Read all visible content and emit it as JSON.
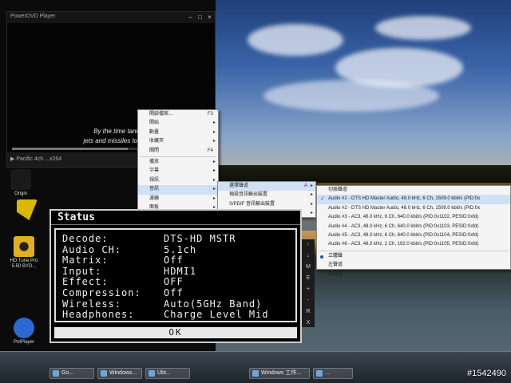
{
  "player": {
    "title": "PowerDVD Player",
    "subtitle_line1": "By the time tanks,",
    "subtitle_line2": "jets and missiles took it d",
    "progress": 0.58,
    "control_text": "Pacific  4ch  ...x264"
  },
  "desktop_icons": [
    {
      "label": "Origin",
      "color": "#d8c000"
    },
    {
      "label": "",
      "color": "#e3c02a"
    },
    {
      "label": "HD Tune Pro 5.50 BYD...",
      "color": "#d4a020"
    },
    {
      "label": "PotPlayer",
      "color": "#2a6ad0"
    }
  ],
  "context_menu": {
    "items": [
      {
        "label": "開啟檔案...",
        "accel": "F3",
        "submenu": false
      },
      {
        "label": "開始",
        "accel": "",
        "submenu": true
      },
      {
        "label": "動畫",
        "accel": "",
        "submenu": true
      },
      {
        "label": "收藏夾",
        "accel": "",
        "submenu": true
      },
      {
        "label": "關閉",
        "accel": "F4",
        "submenu": false
      },
      {
        "label": "播放",
        "accel": "",
        "submenu": true
      },
      {
        "label": "字幕",
        "accel": "",
        "submenu": true
      },
      {
        "label": "視訊",
        "accel": "",
        "submenu": true
      },
      {
        "label": "音訊",
        "accel": "",
        "submenu": true,
        "highlight": true
      },
      {
        "label": "濾鏡",
        "accel": "",
        "submenu": true
      },
      {
        "label": "面板",
        "accel": "",
        "submenu": true
      },
      {
        "label": "其它",
        "accel": "",
        "submenu": true
      }
    ]
  },
  "audio_menu": {
    "items": [
      {
        "label": "選擇聲道",
        "accel": "A",
        "submenu": true,
        "highlight": true
      },
      {
        "label": "預設音訊輸出裝置",
        "accel": "",
        "submenu": true
      },
      {
        "label": "S/PDIF 音訊輸出裝置",
        "accel": "",
        "submenu": true
      },
      {
        "label": "輸出揚聲器",
        "accel": "",
        "submenu": true
      }
    ]
  },
  "track_menu": {
    "header": "切換聲道",
    "tracks": [
      {
        "label": "Audio #1 - DTS HD Master Audio, 48.0 kHz, 6 Ch, 1509.0 kbit/s (PID:0x",
        "checked": true
      },
      {
        "label": "Audio #2 - DTS HD Master Audio, 48.0 kHz, 6 Ch, 1509.0 kbit/s (PID:0x",
        "checked": false
      },
      {
        "label": "Audio #3 - AC3, 48.0 kHz, 6 Ch, 640.0 kbit/s (PID:0x1102, PESID:0xfd)",
        "checked": false
      },
      {
        "label": "Audio #4 - AC3, 48.0 kHz, 6 Ch, 640.0 kbit/s (PID:0x1103, PESID:0xfd)",
        "checked": false
      },
      {
        "label": "Audio #5 - AC3, 48.0 kHz, 6 Ch, 640.0 kbit/s (PID:0x1104, PESID:0xfd)",
        "checked": false
      },
      {
        "label": "Audio #6 - AC3, 48.0 kHz, 2 Ch, 192.0 kbit/s (PID:0x1105, PESID:0xfd)",
        "checked": false
      }
    ],
    "modes": [
      {
        "label": "立體聲",
        "selected": true
      },
      {
        "label": "左聲道",
        "selected": false
      },
      {
        "label": "右聲道",
        "selected": false
      }
    ]
  },
  "status_osd": {
    "title": "Status",
    "rows": [
      {
        "key": "Decode:",
        "value": "DTS-HD MSTR"
      },
      {
        "key": "Audio CH:",
        "value": "5.1ch"
      },
      {
        "key": "Matrix:",
        "value": "Off"
      },
      {
        "key": "Input:",
        "value": "HDMI1"
      },
      {
        "key": "Effect:",
        "value": "OFF"
      },
      {
        "key": "Compression:",
        "value": "Off"
      },
      {
        "key": "Wireless:",
        "value": "Auto(5GHz Band)"
      },
      {
        "key": "Headphones:",
        "value": "Charge Level Mid"
      }
    ],
    "ok_label": "OK"
  },
  "side_strip": [
    "↑",
    "↓",
    "M",
    "E",
    "+",
    "-",
    "R",
    "X"
  ],
  "taskbar": {
    "tasks": [
      {
        "label": "Go..."
      },
      {
        "label": "Windows..."
      },
      {
        "label": "Ubt..."
      },
      {
        "label": "Windows 工作..."
      },
      {
        "label": "..."
      }
    ]
  },
  "watermark": "#1542490"
}
